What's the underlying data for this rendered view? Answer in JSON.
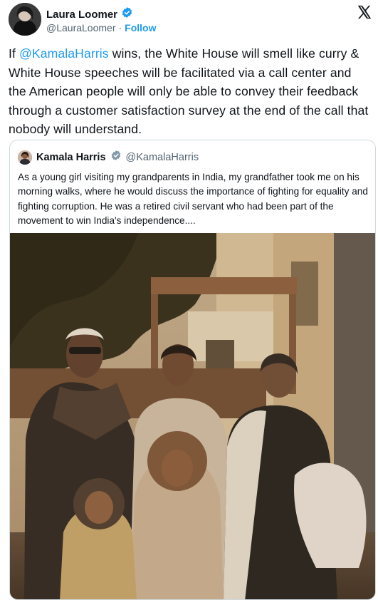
{
  "author": {
    "display_name": "Laura Loomer",
    "handle": "@LauraLoomer",
    "separator": "·",
    "follow_label": "Follow"
  },
  "tweet": {
    "prefix": "If ",
    "mention": "@KamalaHarris",
    "body": " wins, the White House will smell like curry & White House speeches will be facilitated via a call center and the American people will only be able to convey their feedback through a customer satisfaction survey at the end of the call that nobody will understand."
  },
  "quote": {
    "display_name": "Kamala Harris",
    "handle": "@KamalaHarris",
    "text": "As a young girl visiting my grandparents in India, my grandfather took me on his morning walks, where he would discuss the importance of fighting for equality and fighting corruption. He was a retired civil servant who had been part of the movement to win India's independence...."
  },
  "icons": {
    "verified": "verified-badge-icon",
    "platform": "x-logo-icon"
  },
  "colors": {
    "accent": "#1d9bf0",
    "text": "#0f1419",
    "secondary": "#536471",
    "border": "#cfd9de"
  }
}
